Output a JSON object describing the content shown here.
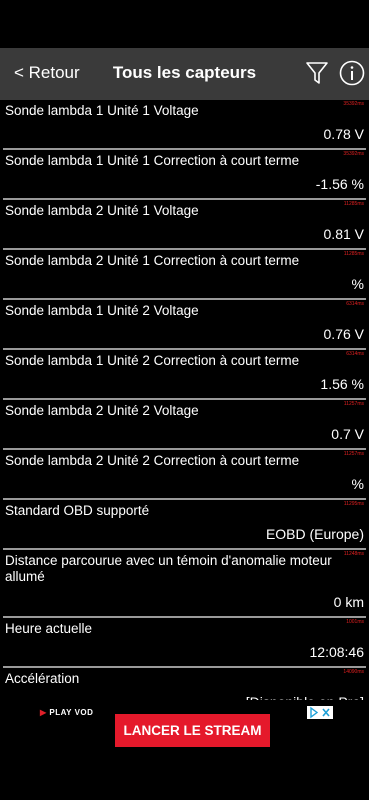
{
  "header": {
    "back_label": "< Retour",
    "title": "Tous les capteurs",
    "filter_icon": "filter-icon",
    "info_icon": "info-icon"
  },
  "sensors": [
    {
      "name": "Sonde lambda 1 Unité 1 Voltage",
      "time": "35392ms",
      "value": "0.78 V"
    },
    {
      "name": "Sonde lambda 1 Unité 1 Correction à court terme",
      "time": "35392ms",
      "value": "-1.56 %"
    },
    {
      "name": "Sonde lambda 2 Unité 1 Voltage",
      "time": "11285ms",
      "value": "0.81 V"
    },
    {
      "name": "Sonde lambda 2 Unité 1 Correction à court terme",
      "time": "11285ms",
      "value": "%"
    },
    {
      "name": "Sonde lambda 1 Unité 2 Voltage",
      "time": "6314ms",
      "value": "0.76 V"
    },
    {
      "name": "Sonde lambda 1 Unité 2 Correction à court terme",
      "time": "6314ms",
      "value": "1.56 %"
    },
    {
      "name": "Sonde lambda 2 Unité 2 Voltage",
      "time": "11257ms",
      "value": "0.7 V"
    },
    {
      "name": "Sonde lambda 2 Unité 2 Correction à court terme",
      "time": "11257ms",
      "value": "%"
    },
    {
      "name": "Standard OBD  supporté",
      "time": "11295ms",
      "value": "EOBD (Europe)"
    },
    {
      "name": "Distance parcourue avec un témoin d'anomalie moteur allumé",
      "time": "11248ms",
      "value": "0 km"
    },
    {
      "name": "Heure actuelle",
      "time": "1001ms",
      "value": "12:08:46"
    },
    {
      "name": "Accélération",
      "time": "14090ms",
      "value": "[Disponible en Pro]"
    }
  ],
  "ad": {
    "brand_prefix": "PLAY",
    "brand_suffix": "VOD",
    "button_label": "LANCER LE STREAM",
    "adchoices_icon": "adchoices-icon",
    "colors": {
      "button": "#e5192b"
    }
  },
  "colors": {
    "header_bg": "#3a3a3a",
    "divider": "#9a9a9a",
    "timestamp": "#e02020"
  }
}
